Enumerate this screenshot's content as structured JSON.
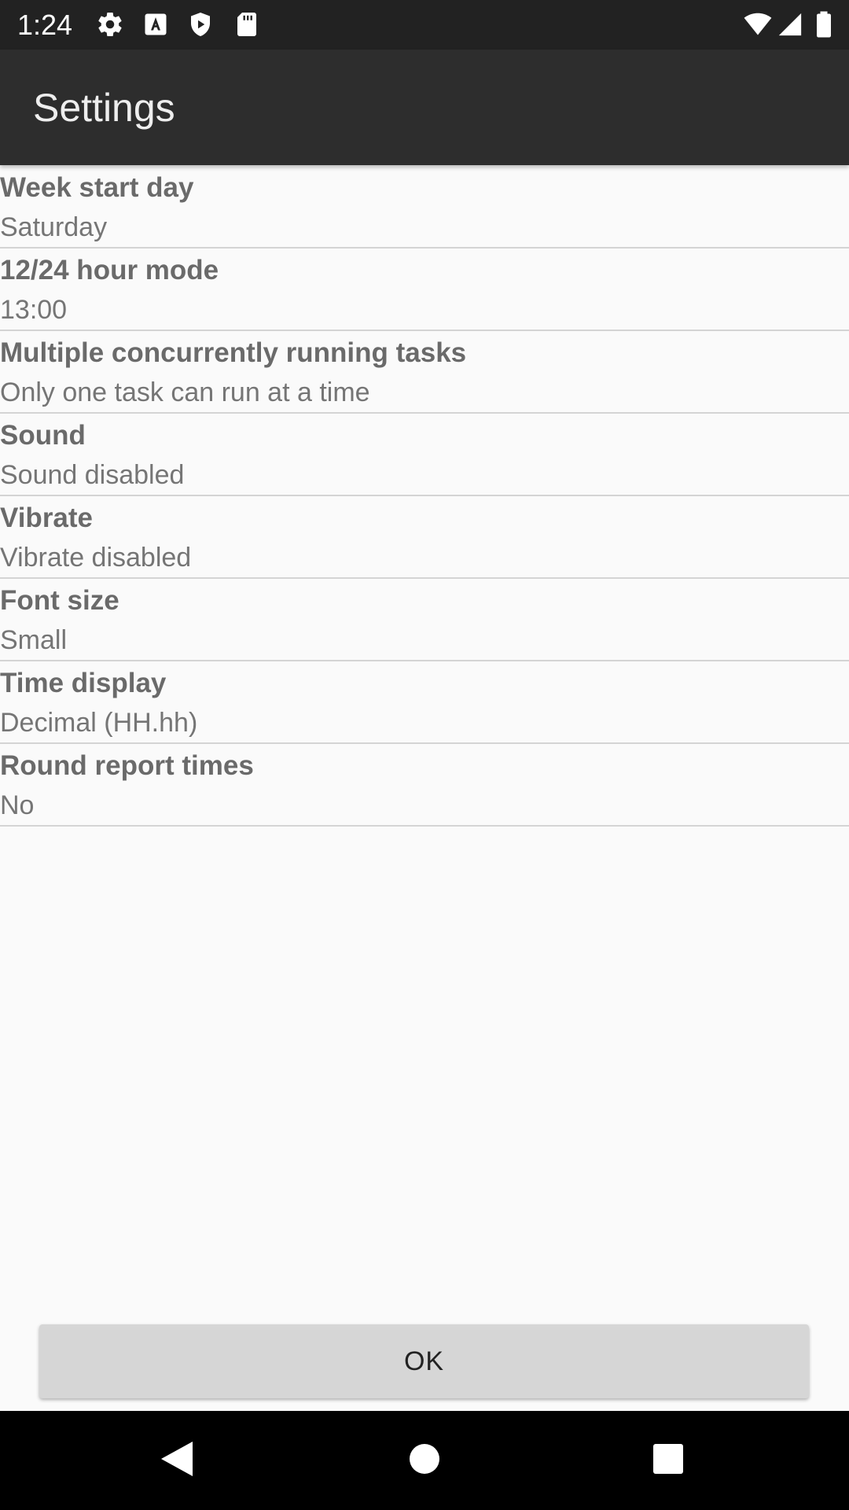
{
  "status_bar": {
    "time": "1:24",
    "icons_left": [
      "gear-icon",
      "font-a-icon",
      "shield-play-icon",
      "sd-card-icon"
    ],
    "icons_right": [
      "wifi-icon",
      "signal-icon",
      "battery-icon"
    ]
  },
  "app_bar": {
    "title": "Settings"
  },
  "settings": [
    {
      "title": "Week start day",
      "value": "Saturday"
    },
    {
      "title": "12/24 hour mode",
      "value": "13:00"
    },
    {
      "title": "Multiple concurrently running tasks",
      "value": "Only one task can run at a time"
    },
    {
      "title": "Sound",
      "value": "Sound disabled"
    },
    {
      "title": "Vibrate",
      "value": "Vibrate disabled"
    },
    {
      "title": "Font size",
      "value": "Small"
    },
    {
      "title": "Time display",
      "value": "Decimal (HH.hh)"
    },
    {
      "title": "Round report times",
      "value": "No"
    }
  ],
  "ok_button": {
    "label": "OK"
  },
  "nav_bar": {
    "icons": [
      "back-triangle-icon",
      "home-circle-icon",
      "recents-square-icon"
    ]
  },
  "colors": {
    "status_bar": "#222222",
    "app_bar": "#2d2d2d",
    "background": "#fafafa",
    "button": "#d6d6d6",
    "nav_bar": "#000000"
  }
}
